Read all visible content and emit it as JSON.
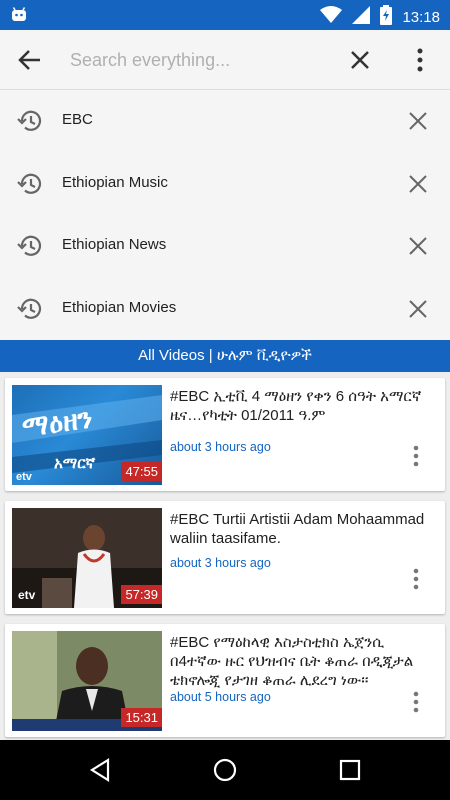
{
  "status_bar": {
    "time": "13:18"
  },
  "search": {
    "placeholder": "Search everything..."
  },
  "history": [
    {
      "label": "EBC"
    },
    {
      "label": "Ethiopian Music"
    },
    {
      "label": "Ethiopian News"
    },
    {
      "label": "Ethiopian Movies"
    }
  ],
  "banner": {
    "label": "All Videos | ሁሉም ቪዲዮዎች"
  },
  "videos": [
    {
      "title": "#EBC ኢቲቪ 4 ማዕዘን የቀን 6 ሰዓት አማርኛ ዜና…የካቲት 01/2011 ዓ.ም",
      "time": "about 3 hours ago",
      "duration": "47:55",
      "thumb_text": "ማዕዘን",
      "thumb_sub": "አማርኛ",
      "thumb_logo": "etv"
    },
    {
      "title": "#EBC Turtii Artistii Adam Mohaammad waliin taasifame.",
      "time": "about 3 hours ago",
      "duration": "57:39",
      "thumb_logo": "etv"
    },
    {
      "title": "#EBC የማዕከላዊ እስታስቲክስ ኤጀንሲ በ4ተኛው ዙር የህዝብና ቤት ቆጠራ በዲጂታል ቴክኖሎጂ የታገዘ ቆጠራ ሊደረግ ነው፡፡",
      "time": "about 5 hours ago",
      "duration": "15:31"
    }
  ],
  "colors": {
    "primary": "#1565c0",
    "duration_badge": "#c62828"
  }
}
